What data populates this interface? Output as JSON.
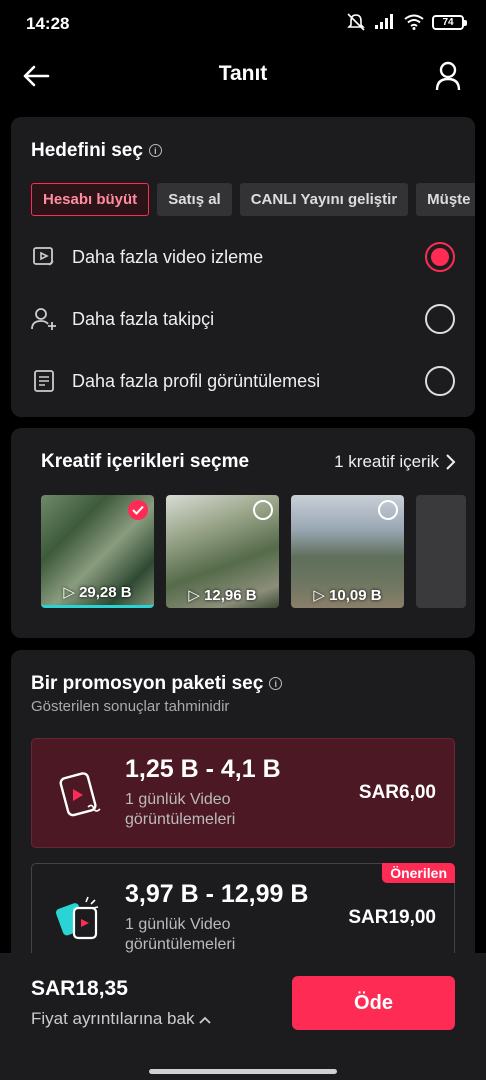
{
  "status_bar": {
    "time": "14:28",
    "battery": "74"
  },
  "header": {
    "title": "Tanıt"
  },
  "goal": {
    "title": "Hedefini seç",
    "tabs": [
      "Hesabı büyüt",
      "Satış al",
      "CANLI Yayını geliştir",
      "Müşte"
    ],
    "options": [
      {
        "label": "Daha fazla video izleme",
        "icon": "video-play-icon",
        "selected": true
      },
      {
        "label": "Daha fazla takipçi",
        "icon": "add-user-icon",
        "selected": false
      },
      {
        "label": "Daha fazla profil görüntülemesi",
        "icon": "document-icon",
        "selected": false
      }
    ]
  },
  "creative": {
    "title": "Kreatif içerikleri seçme",
    "link": "1 kreatif içerik",
    "thumbs": [
      {
        "duration": "29,28 B",
        "selected": true
      },
      {
        "duration": "12,96 B",
        "selected": false
      },
      {
        "duration": "10,09 B",
        "selected": false
      }
    ]
  },
  "promo": {
    "title": "Bir promosyon paketi seç",
    "subtitle": "Gösterilen sonuçlar tahminidir",
    "packages": [
      {
        "range": "1,25 B - 4,1 B",
        "desc": "1 günlük Video görüntülemeleri",
        "price": "SAR6,00"
      },
      {
        "range": "3,97 B - 12,99 B",
        "desc": "1 günlük Video görüntülemeleri",
        "price": "SAR19,00",
        "badge": "Önerilen"
      }
    ]
  },
  "footer": {
    "total": "SAR18,35",
    "details": "Fiyat ayrıntılarına bak",
    "pay": "Öde"
  },
  "colors": {
    "accent": "#fe2c55",
    "card": "#1c1c1e",
    "selected_pkg": "#4c1823"
  }
}
